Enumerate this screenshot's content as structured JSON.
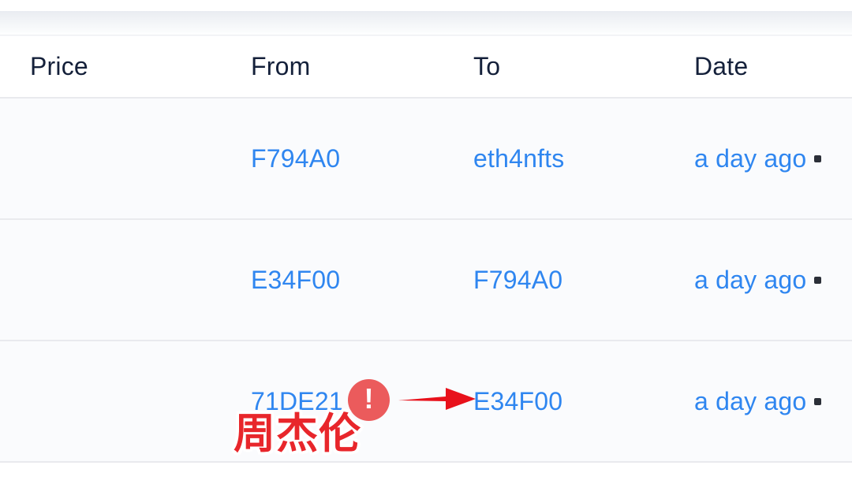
{
  "table": {
    "columns": [
      {
        "key": "price",
        "label": "Price"
      },
      {
        "key": "from",
        "label": "From"
      },
      {
        "key": "to",
        "label": "To"
      },
      {
        "key": "date",
        "label": "Date"
      }
    ],
    "rows": [
      {
        "price": "",
        "from": "F794A0",
        "to": "eth4nfts",
        "date": "a day ago"
      },
      {
        "price": "",
        "from": "E34F00",
        "to": "F794A0",
        "date": "a day ago"
      },
      {
        "price": "",
        "from": "71DE21",
        "to": "E34F00",
        "date": "a day ago"
      }
    ]
  },
  "annotation": {
    "alert_icon": "exclamation-circle-icon",
    "alert_glyph": "!",
    "arrow_icon": "arrow-right-icon",
    "label_text": "周杰伦"
  },
  "colors": {
    "link": "#2f86f0",
    "header_text": "#14203a",
    "row_background": "#fafbfd",
    "row_divider": "#e9eaee",
    "annotation_red": "#e8262b",
    "badge_red": "#eb5b5c"
  }
}
